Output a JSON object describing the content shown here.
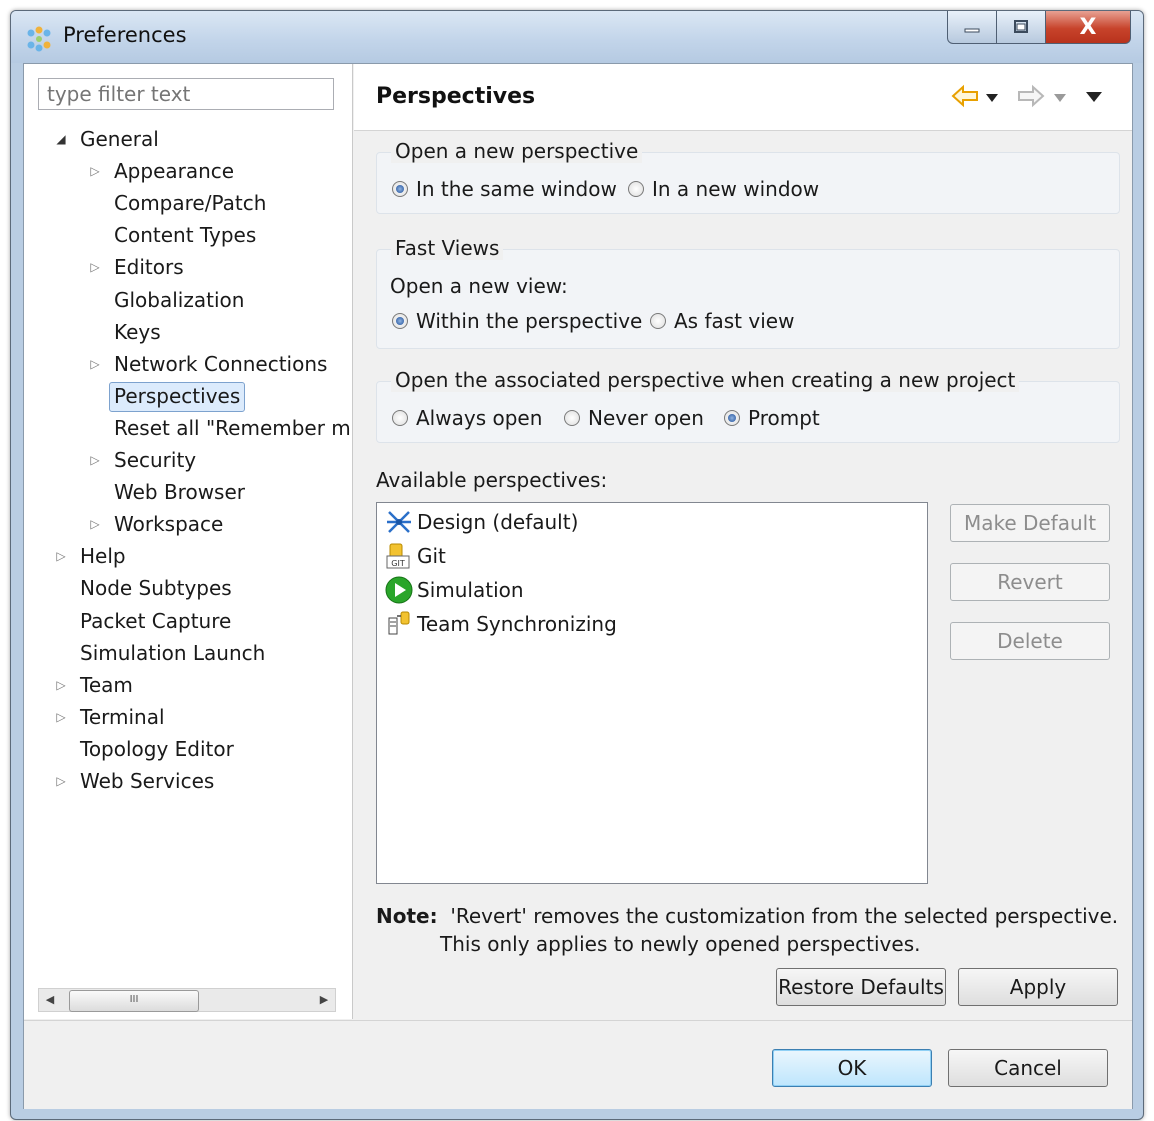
{
  "window": {
    "title": "Preferences",
    "minimize_icon": "minimize-icon",
    "maximize_icon": "maximize-icon",
    "close_icon": "close-icon",
    "close_glyph": "X"
  },
  "sidebar": {
    "filter_placeholder": "type filter text",
    "tree": [
      {
        "label": "General",
        "level": 0,
        "twisty": "open"
      },
      {
        "label": "Appearance",
        "level": 1,
        "twisty": "closed"
      },
      {
        "label": "Compare/Patch",
        "level": 1,
        "twisty": "none"
      },
      {
        "label": "Content Types",
        "level": 1,
        "twisty": "none"
      },
      {
        "label": "Editors",
        "level": 1,
        "twisty": "closed"
      },
      {
        "label": "Globalization",
        "level": 1,
        "twisty": "none"
      },
      {
        "label": "Keys",
        "level": 1,
        "twisty": "none"
      },
      {
        "label": "Network Connections",
        "level": 1,
        "twisty": "closed"
      },
      {
        "label": "Perspectives",
        "level": 1,
        "twisty": "none",
        "selected": true
      },
      {
        "label": "Reset all \"Remember m",
        "level": 1,
        "twisty": "none"
      },
      {
        "label": "Security",
        "level": 1,
        "twisty": "closed"
      },
      {
        "label": "Web Browser",
        "level": 1,
        "twisty": "none"
      },
      {
        "label": "Workspace",
        "level": 1,
        "twisty": "closed"
      },
      {
        "label": "Help",
        "level": 0,
        "twisty": "closed"
      },
      {
        "label": "Node Subtypes",
        "level": 0,
        "twisty": "none"
      },
      {
        "label": "Packet Capture",
        "level": 0,
        "twisty": "none"
      },
      {
        "label": "Simulation Launch",
        "level": 0,
        "twisty": "none"
      },
      {
        "label": "Team",
        "level": 0,
        "twisty": "closed"
      },
      {
        "label": "Terminal",
        "level": 0,
        "twisty": "closed"
      },
      {
        "label": "Topology Editor",
        "level": 0,
        "twisty": "none"
      },
      {
        "label": "Web Services",
        "level": 0,
        "twisty": "closed"
      }
    ],
    "scroll_thumb_glyph": "III"
  },
  "page": {
    "title": "Perspectives",
    "open_perspective": {
      "label": "Open a new perspective",
      "options": [
        {
          "label": "In the same window",
          "selected": true
        },
        {
          "label": "In a new window",
          "selected": false
        }
      ]
    },
    "fast_views": {
      "label": "Fast Views",
      "sublabel": "Open a new view:",
      "options": [
        {
          "label": "Within the perspective",
          "selected": true
        },
        {
          "label": "As fast view",
          "selected": false
        }
      ]
    },
    "new_project": {
      "label": "Open the associated perspective when creating a new project",
      "options": [
        {
          "label": "Always open",
          "selected": false
        },
        {
          "label": "Never open",
          "selected": false
        },
        {
          "label": "Prompt",
          "selected": true
        }
      ]
    },
    "available_label": "Available perspectives:",
    "perspectives": [
      {
        "label": "Design (default)",
        "icon": "design-perspective-icon"
      },
      {
        "label": "Git",
        "icon": "git-perspective-icon",
        "icon_text": "GIT"
      },
      {
        "label": "Simulation",
        "icon": "simulation-play-icon"
      },
      {
        "label": "Team Synchronizing",
        "icon": "team-synchronizing-icon"
      }
    ],
    "buttons": {
      "make_default": "Make Default",
      "revert": "Revert",
      "delete": "Delete",
      "restore_defaults": "Restore Defaults",
      "apply": "Apply"
    },
    "note_bold": "Note:",
    "note_line1": "'Revert' removes the customization from the selected perspective.",
    "note_line2": "This only applies to newly opened perspectives."
  },
  "footer": {
    "ok": "OK",
    "cancel": "Cancel"
  },
  "colors": {
    "selection_bg": "#dcebfc",
    "selection_border": "#7da2ce",
    "nav_arrow": "#e8a000",
    "close_button": "#c7432b"
  }
}
